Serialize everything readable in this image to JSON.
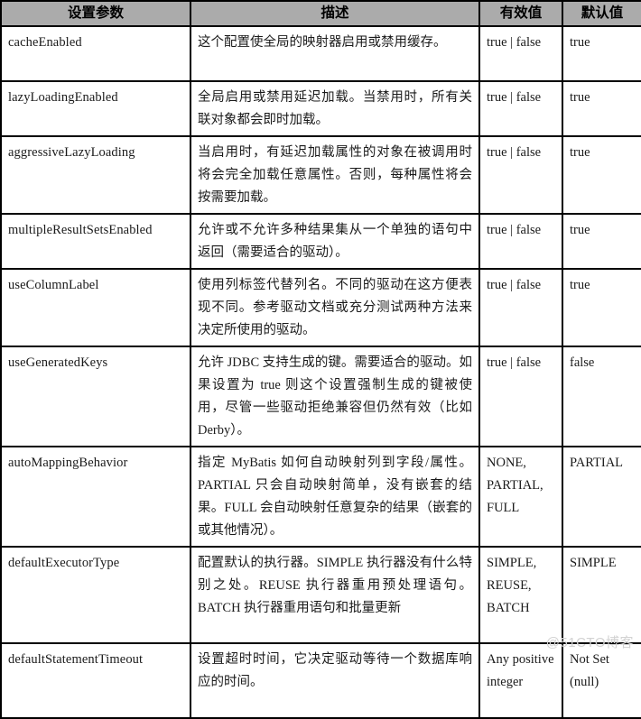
{
  "table": {
    "columns": [
      {
        "key": "param",
        "label": "设置参数"
      },
      {
        "key": "desc",
        "label": "描述"
      },
      {
        "key": "valid",
        "label": "有效值"
      },
      {
        "key": "default",
        "label": "默认值"
      }
    ],
    "rows": [
      {
        "param": "cacheEnabled",
        "desc": "这个配置使全局的映射器启用或禁用缓存。",
        "valid": "true | false",
        "default": "true"
      },
      {
        "param": "lazyLoadingEnabled",
        "desc": "全局启用或禁用延迟加载。当禁用时，所有关联对象都会即时加载。",
        "valid": "true | false",
        "default": "true"
      },
      {
        "param": "aggressiveLazyLoading",
        "desc": "当启用时，有延迟加载属性的对象在被调用时将会完全加载任意属性。否则，每种属性将会按需要加载。",
        "valid": "true | false",
        "default": "true"
      },
      {
        "param": "multipleResultSetsEnabled",
        "desc": "允许或不允许多种结果集从一个单独的语句中返回（需要适合的驱动）。",
        "valid": "true | false",
        "default": "true"
      },
      {
        "param": "useColumnLabel",
        "desc": "使用列标签代替列名。不同的驱动在这方便表现不同。参考驱动文档或充分测试两种方法来决定所使用的驱动。",
        "valid": "true | false",
        "default": "true"
      },
      {
        "param": "useGeneratedKeys",
        "desc": "允许 JDBC 支持生成的键。需要适合的驱动。如果设置为 true 则这个设置强制生成的键被使用，尽管一些驱动拒绝兼容但仍然有效（比如 Derby）。",
        "valid": "true | false",
        "default": "false"
      },
      {
        "param": "autoMappingBehavior",
        "desc": "指定 MyBatis 如何自动映射列到字段/属性。PARTIAL 只会自动映射简单，没有嵌套的结果。FULL 会自动映射任意复杂的结果（嵌套的或其他情况）。",
        "valid": "NONE, PARTIAL, FULL",
        "default": "PARTIAL"
      },
      {
        "param": "defaultExecutorType",
        "desc": "配置默认的执行器。SIMPLE 执行器没有什么特别之处。REUSE 执行器重用预处理语句。BATCH 执行器重用语句和批量更新",
        "valid": "SIMPLE, REUSE, BATCH",
        "default": "SIMPLE"
      },
      {
        "param": "defaultStatementTimeout",
        "desc": "设置超时时间，它决定驱动等待一个数据库响应的时间。",
        "valid": "Any positive integer",
        "default": "Not Set (null)"
      }
    ]
  },
  "watermark": {
    "text": "@51CTO博客"
  },
  "colors": {
    "header_background": "#ababab",
    "border": "#000000",
    "text": "#1a1a1a",
    "watermark": "#d2d2d2"
  }
}
